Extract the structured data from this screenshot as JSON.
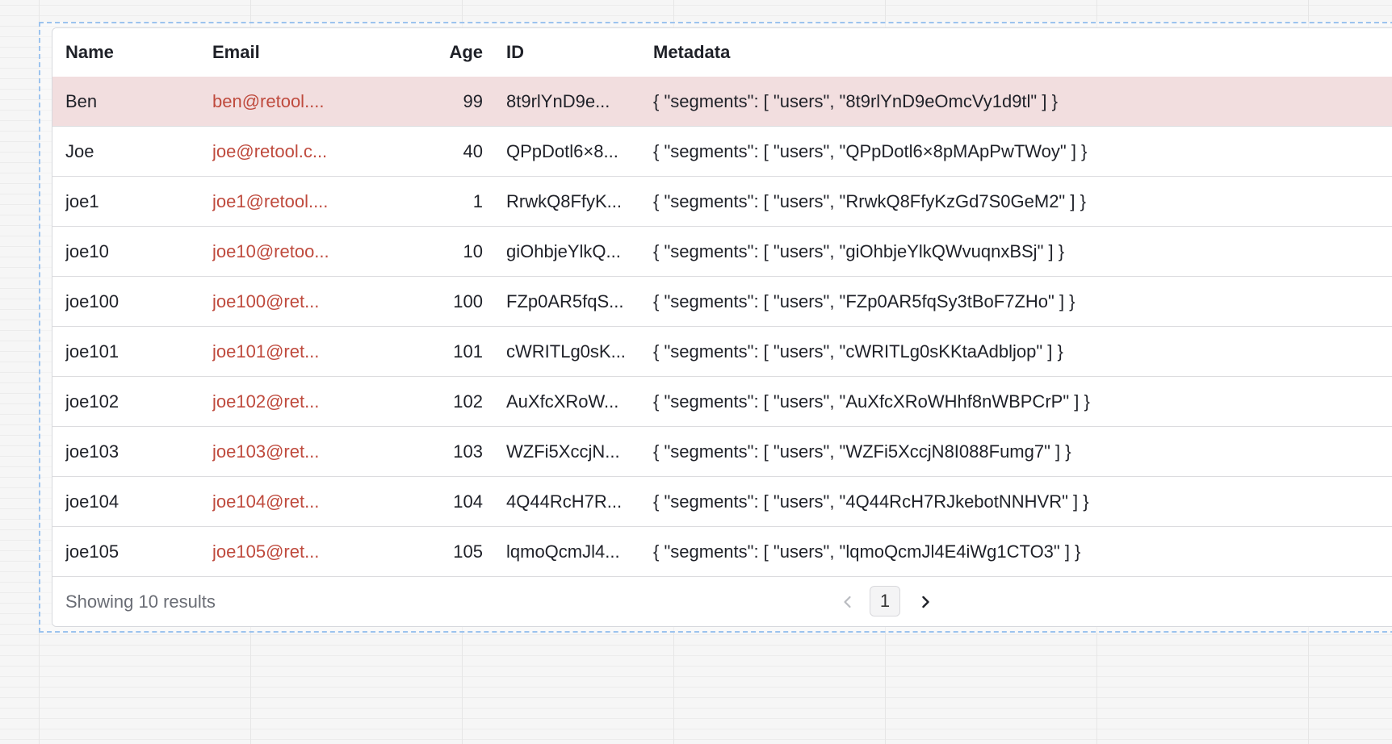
{
  "table": {
    "columns": [
      {
        "key": "name",
        "label": "Name"
      },
      {
        "key": "email",
        "label": "Email"
      },
      {
        "key": "age",
        "label": "Age"
      },
      {
        "key": "id",
        "label": "ID"
      },
      {
        "key": "metadata",
        "label": "Metadata"
      }
    ],
    "rows": [
      {
        "name": "Ben",
        "email": "ben@retool....",
        "age": "99",
        "id": "8t9rlYnD9e...",
        "metadata": "{ \"segments\": [ \"users\", \"8t9rlYnD9eOmcVy1d9tl\" ] }",
        "selected": true
      },
      {
        "name": "Joe",
        "email": "joe@retool.c...",
        "age": "40",
        "id": "QPpDotl6×8...",
        "metadata": "{ \"segments\": [ \"users\", \"QPpDotl6×8pMApPwTWoy\" ] }"
      },
      {
        "name": "joe1",
        "email": "joe1@retool....",
        "age": "1",
        "id": "RrwkQ8FfyK...",
        "metadata": "{ \"segments\": [ \"users\", \"RrwkQ8FfyKzGd7S0GeM2\" ] }"
      },
      {
        "name": "joe10",
        "email": "joe10@retoo...",
        "age": "10",
        "id": "giOhbjeYlkQ...",
        "metadata": "{ \"segments\": [ \"users\", \"giOhbjeYlkQWvuqnxBSj\" ] }"
      },
      {
        "name": "joe100",
        "email": "joe100@ret...",
        "age": "100",
        "id": "FZp0AR5fqS...",
        "metadata": "{ \"segments\": [ \"users\", \"FZp0AR5fqSy3tBoF7ZHo\" ] }"
      },
      {
        "name": "joe101",
        "email": "joe101@ret...",
        "age": "101",
        "id": "cWRITLg0sK...",
        "metadata": "{ \"segments\": [ \"users\", \"cWRITLg0sKKtaAdbljop\" ] }"
      },
      {
        "name": "joe102",
        "email": "joe102@ret...",
        "age": "102",
        "id": "AuXfcXRoW...",
        "metadata": "{ \"segments\": [ \"users\", \"AuXfcXRoWHhf8nWBPCrP\" ] }"
      },
      {
        "name": "joe103",
        "email": "joe103@ret...",
        "age": "103",
        "id": "WZFi5XccjN...",
        "metadata": "{ \"segments\": [ \"users\", \"WZFi5XccjN8I088Fumg7\" ] }"
      },
      {
        "name": "joe104",
        "email": "joe104@ret...",
        "age": "104",
        "id": "4Q44RcH7R...",
        "metadata": "{ \"segments\": [ \"users\", \"4Q44RcH7RJkebotNNHVR\" ] }"
      },
      {
        "name": "joe105",
        "email": "joe105@ret...",
        "age": "105",
        "id": "lqmoQcmJl4...",
        "metadata": "{ \"segments\": [ \"users\", \"lqmoQcmJl4E4iWg1CTO3\" ] }"
      }
    ]
  },
  "footer": {
    "result_count": "Showing 10 results",
    "current_page": "1",
    "prev_icon": "chevron-left-icon",
    "next_icon": "chevron-right-icon"
  },
  "colors": {
    "selected_row": "#f2dedf",
    "email_link": "#bf4a3d",
    "selection_frame": "#9cc3ee"
  }
}
